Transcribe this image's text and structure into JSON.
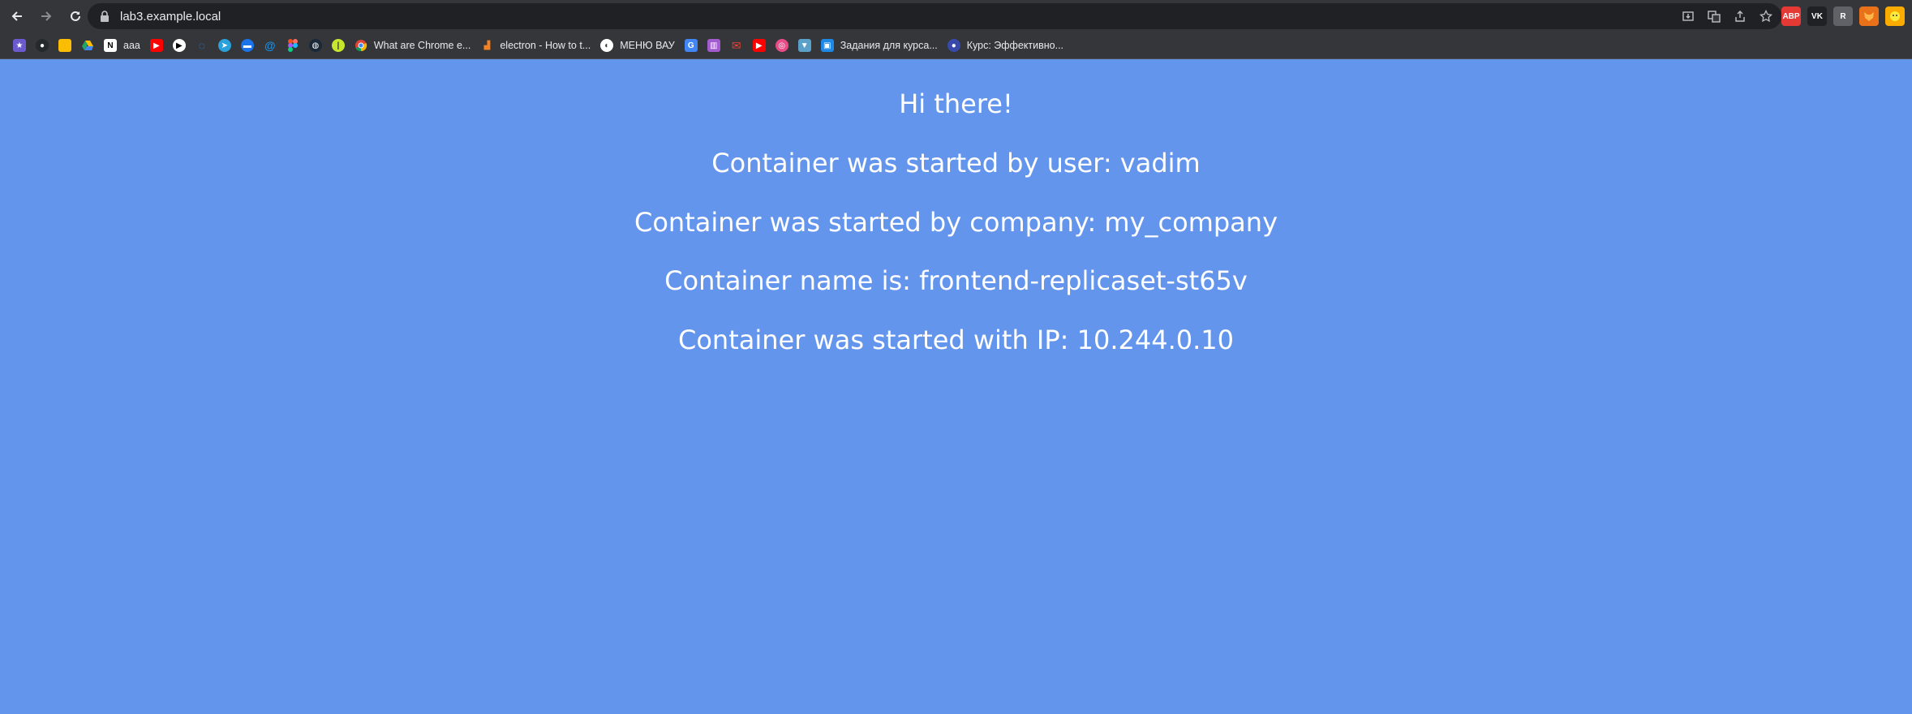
{
  "browser": {
    "url": "lab3.example.local",
    "bookmarks": [
      {
        "icon": "flag-icon",
        "label": "",
        "color": "#6a5acd"
      },
      {
        "icon": "github-icon",
        "label": "",
        "color": "#24292e"
      },
      {
        "icon": "keep-icon",
        "label": "",
        "color": "#fbbc04"
      },
      {
        "icon": "drive-icon",
        "label": "",
        "color": "#1fa463"
      },
      {
        "icon": "notion-icon",
        "label": "aaa",
        "color": "#ffffff"
      },
      {
        "icon": "youtube-icon",
        "label": "",
        "color": "#ff0000"
      },
      {
        "icon": "play-icon",
        "label": "",
        "color": "#ffffff"
      },
      {
        "icon": "loader-icon",
        "label": "",
        "color": "#1e90ff"
      },
      {
        "icon": "telegram-icon",
        "label": "",
        "color": "#2aa1da"
      },
      {
        "icon": "chat-icon",
        "label": "",
        "color": "#1a73e8"
      },
      {
        "icon": "mail-at-icon",
        "label": "",
        "color": "#168de2"
      },
      {
        "icon": "figma-icon",
        "label": "",
        "color": "#f24e1e"
      },
      {
        "icon": "steam-icon",
        "label": "",
        "color": "#1b2838"
      },
      {
        "icon": "lime-icon",
        "label": "",
        "color": "#c6e82c"
      },
      {
        "icon": "chrome-icon",
        "label": "What are Chrome e...",
        "color": "#4285f4"
      },
      {
        "icon": "electron-icon",
        "label": "electron - How to t...",
        "color": "#f48024"
      },
      {
        "icon": "globe-icon",
        "label": "МЕНЮ ВАУ",
        "color": "#ffffff"
      },
      {
        "icon": "translate-icon",
        "label": "",
        "color": "#4285f4"
      },
      {
        "icon": "trello-icon",
        "label": "",
        "color": "#a35bd0"
      },
      {
        "icon": "gmail-icon",
        "label": "",
        "color": "#ea4335"
      },
      {
        "icon": "youtube-icon",
        "label": "",
        "color": "#ff0000"
      },
      {
        "icon": "dribbble-icon",
        "label": "",
        "color": "#ea4c89"
      },
      {
        "icon": "shirt-icon",
        "label": "",
        "color": "#5aa0c8"
      },
      {
        "icon": "classroom-icon",
        "label": "Задания для курса...",
        "color": "#1e88e5"
      },
      {
        "icon": "course-icon",
        "label": "Курс: Эффективно...",
        "color": "#3949ab"
      }
    ],
    "extensions": [
      {
        "icon": "adblock-icon",
        "text": "ABP",
        "color": "#e53935"
      },
      {
        "icon": "vk-icon",
        "text": "VK",
        "color": "#202124"
      },
      {
        "icon": "r-extension-icon",
        "text": "R",
        "color": "#5f6368"
      },
      {
        "icon": "fox-icon",
        "text": "",
        "color": "#e8711a"
      },
      {
        "icon": "emoji-extension-icon",
        "text": "",
        "color": "#f9ab00"
      }
    ]
  },
  "page": {
    "background": "#6495ed",
    "greeting": "Hi there!",
    "user_line": "Container was started by user: vadim",
    "company_line": "Container was started by company: my_company",
    "name_line": "Container name is: frontend-replicaset-st65v",
    "ip_line": "Container was started with IP: 10.244.0.10"
  }
}
